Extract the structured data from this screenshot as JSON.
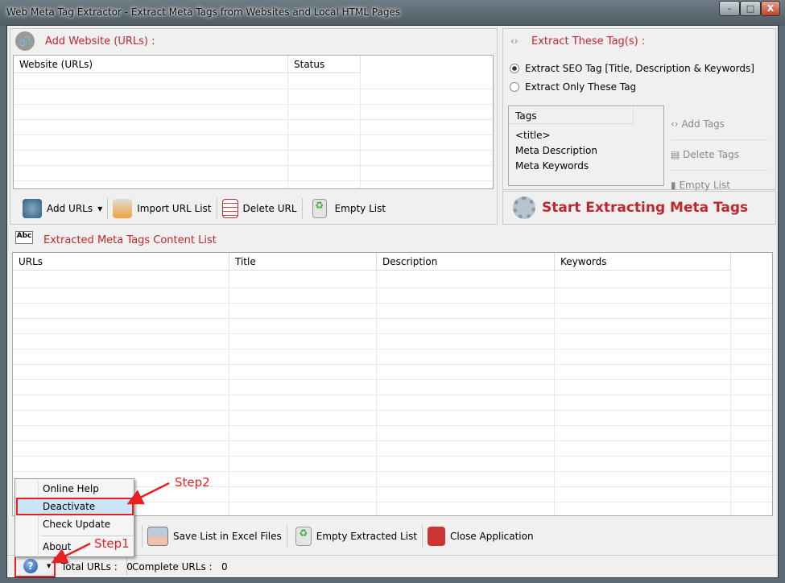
{
  "window": {
    "title": "Web Meta Tag Extractor - Extract Meta Tags from Websites and Local HTML Pages",
    "icon": "code-icon",
    "controls": [
      "minimize",
      "maximize",
      "close"
    ]
  },
  "add_website": {
    "header": "Add Website (URLs) :",
    "columns": [
      "Website (URLs)",
      "Status"
    ],
    "toolbar": {
      "add_urls": "Add URLs",
      "import_url_list": "Import URL List",
      "delete_url": "Delete URL",
      "empty_list": "Empty List"
    }
  },
  "extract_tags": {
    "header": "Extract These Tag(s) :",
    "options": [
      {
        "label": "Extract SEO Tag [Title, Description & Keywords]",
        "selected": true
      },
      {
        "label": "Extract Only These Tag",
        "selected": false
      }
    ],
    "tags_header": "Tags",
    "tags": [
      "<title>",
      "Meta Description",
      "Meta Keywords"
    ],
    "buttons": {
      "add_tags": "Add Tags",
      "delete_tags": "Delete Tags",
      "empty_list": "Empty List"
    },
    "start": "Start Extracting Meta Tags"
  },
  "extracted": {
    "header": "Extracted Meta Tags Content List",
    "columns": [
      "URLs",
      "Title",
      "Description",
      "Keywords"
    ],
    "toolbar": {
      "save_excel": "Save List in Excel Files",
      "empty_extracted": "Empty Extracted List",
      "close_app": "Close Application"
    }
  },
  "status": {
    "total_label": "Total URLs :",
    "total_value": "0",
    "complete_label": "Complete URLs :",
    "complete_value": "0"
  },
  "help_menu": {
    "items": [
      "Online Help",
      "Deactivate",
      "Check Update",
      "About"
    ],
    "highlighted": "Deactivate"
  },
  "annotations": {
    "step1": "Step1",
    "step2": "Step2"
  },
  "colors": {
    "accent": "#c0272d",
    "annotation": "#e82020",
    "highlight": "#cce4f7"
  }
}
